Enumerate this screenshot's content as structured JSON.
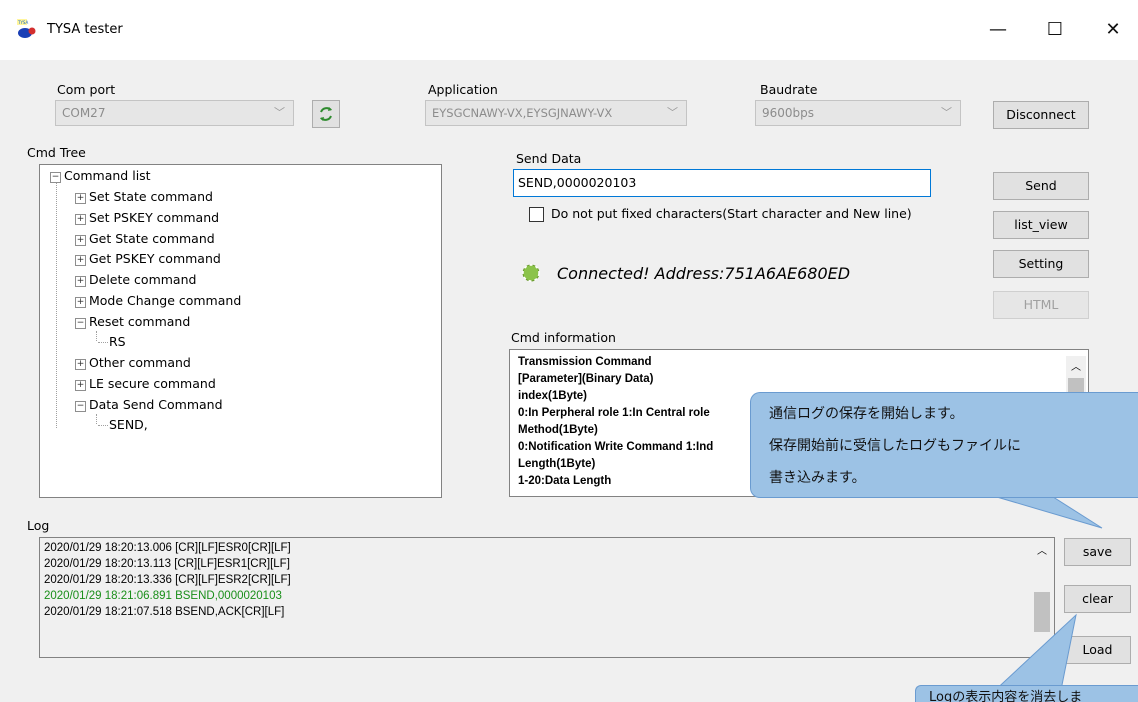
{
  "window": {
    "title": "TYSA tester",
    "icon_label": "TYSA",
    "minimize": "—",
    "maximize": "☐",
    "close": "✕"
  },
  "com_port": {
    "label": "Com port",
    "value": "COM27"
  },
  "application": {
    "label": "Application",
    "value": "EYSGCNAWY-VX,EYSGJNAWY-VX"
  },
  "baudrate": {
    "label": "Baudrate",
    "value": "9600bps"
  },
  "buttons": {
    "disconnect": "Disconnect",
    "send": "Send",
    "list_view": "list_view",
    "setting": "Setting",
    "html": "HTML",
    "save": "save",
    "clear": "clear",
    "load": "Load"
  },
  "cmd_tree": {
    "label": "Cmd Tree",
    "root": "Command list",
    "items": [
      {
        "label": "Set State command",
        "expander": "+"
      },
      {
        "label": "Set PSKEY command",
        "expander": "+"
      },
      {
        "label": "Get State command",
        "expander": "+"
      },
      {
        "label": "Get PSKEY command",
        "expander": "+"
      },
      {
        "label": "Delete command",
        "expander": "+"
      },
      {
        "label": "Mode Change command",
        "expander": "+"
      },
      {
        "label": "Reset command",
        "expander": "−"
      },
      {
        "label": "RS",
        "expander": ""
      },
      {
        "label": "Other command",
        "expander": "+"
      },
      {
        "label": "LE secure command",
        "expander": "+"
      },
      {
        "label": "Data Send Command",
        "expander": "−"
      },
      {
        "label": "SEND,",
        "expander": ""
      }
    ]
  },
  "send_data": {
    "label": "Send Data",
    "value": "SEND,0000020103"
  },
  "fixed_chars_checkbox": {
    "label": "Do not put fixed characters(Start character and New line)",
    "checked": false
  },
  "status": {
    "text": "Connected! Address:751A6AE680ED",
    "indicator_color": "#8bc34a"
  },
  "cmd_information": {
    "label": "Cmd information",
    "lines": [
      "Transmission Command",
      "[Parameter](Binary Data)",
      "index(1Byte)",
      "0:In Perpheral role 1:In Central role",
      "Method(1Byte)",
      "0:Notification Write Command 1:Ind",
      "Length(1Byte)",
      "1-20:Data Length"
    ]
  },
  "log": {
    "label": "Log",
    "lines": [
      {
        "text": "2020/01/29 18:20:13.006 [CR][LF]ESR0[CR][LF]",
        "color": "#000000"
      },
      {
        "text": "2020/01/29 18:20:13.113 [CR][LF]ESR1[CR][LF]",
        "color": "#000000"
      },
      {
        "text": "2020/01/29 18:20:13.336 [CR][LF]ESR2[CR][LF]",
        "color": "#000000"
      },
      {
        "text": "2020/01/29 18:21:06.891 BSEND,0000020103",
        "color": "#1a8f1a"
      },
      {
        "text": "2020/01/29 18:21:07.518 BSEND,ACK[CR][LF]",
        "color": "#000000"
      }
    ]
  },
  "callouts": {
    "save_note_line1": "通信ログの保存を開始します。",
    "save_note_line2": "保存開始前に受信したログもファイルに",
    "save_note_line3": "書き込みます。",
    "clear_note": "Logの表示内容を消去しま"
  }
}
